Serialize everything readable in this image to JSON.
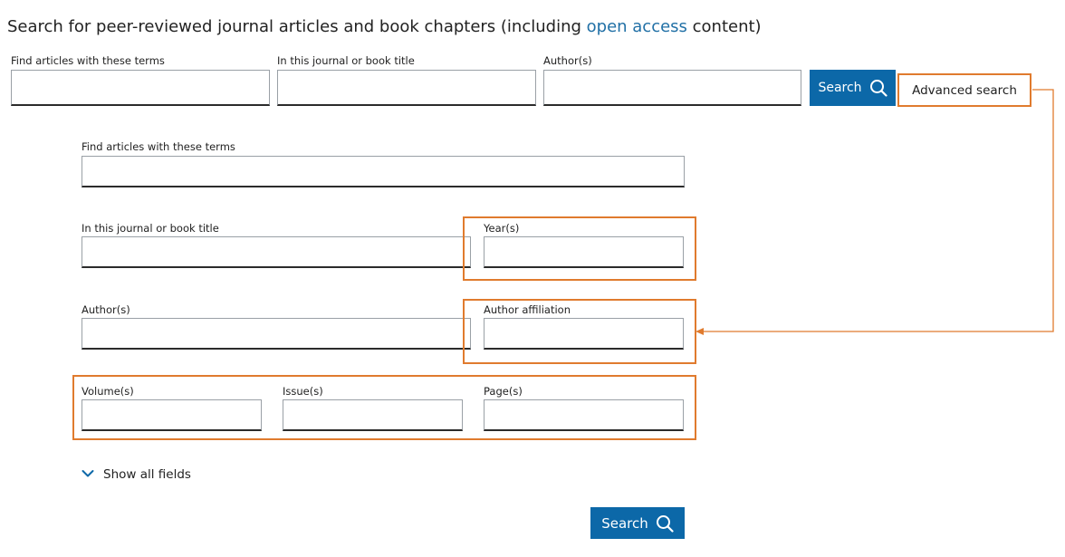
{
  "header": {
    "text_before": "Search for peer-reviewed journal articles and book chapters (including ",
    "link_text": "open access",
    "text_after": " content)"
  },
  "quick_search": {
    "terms_label": "Find articles with these terms",
    "terms_value": "",
    "journal_label": "In this journal or book title",
    "journal_value": "",
    "author_label": "Author(s)",
    "author_value": "",
    "search_label": "Search",
    "advanced_label": "Advanced search"
  },
  "advanced_form": {
    "terms_label": "Find articles with these terms",
    "terms_value": "",
    "journal_label": "In this journal or book title",
    "journal_value": "",
    "years_label": "Year(s)",
    "years_value": "",
    "authors_label": "Author(s)",
    "authors_value": "",
    "affiliation_label": "Author affiliation",
    "affiliation_value": "",
    "volume_label": "Volume(s)",
    "volume_value": "",
    "issue_label": "Issue(s)",
    "issue_value": "",
    "pages_label": "Page(s)",
    "pages_value": "",
    "show_all_label": "Show all fields",
    "search_label": "Search"
  },
  "icons": {
    "search": "search-icon",
    "chevron": "chevron-down-icon"
  },
  "colors": {
    "accent_blue": "#0c68a8",
    "link_blue": "#2170a6",
    "highlight_orange": "#e07b2e",
    "text": "#222222"
  }
}
